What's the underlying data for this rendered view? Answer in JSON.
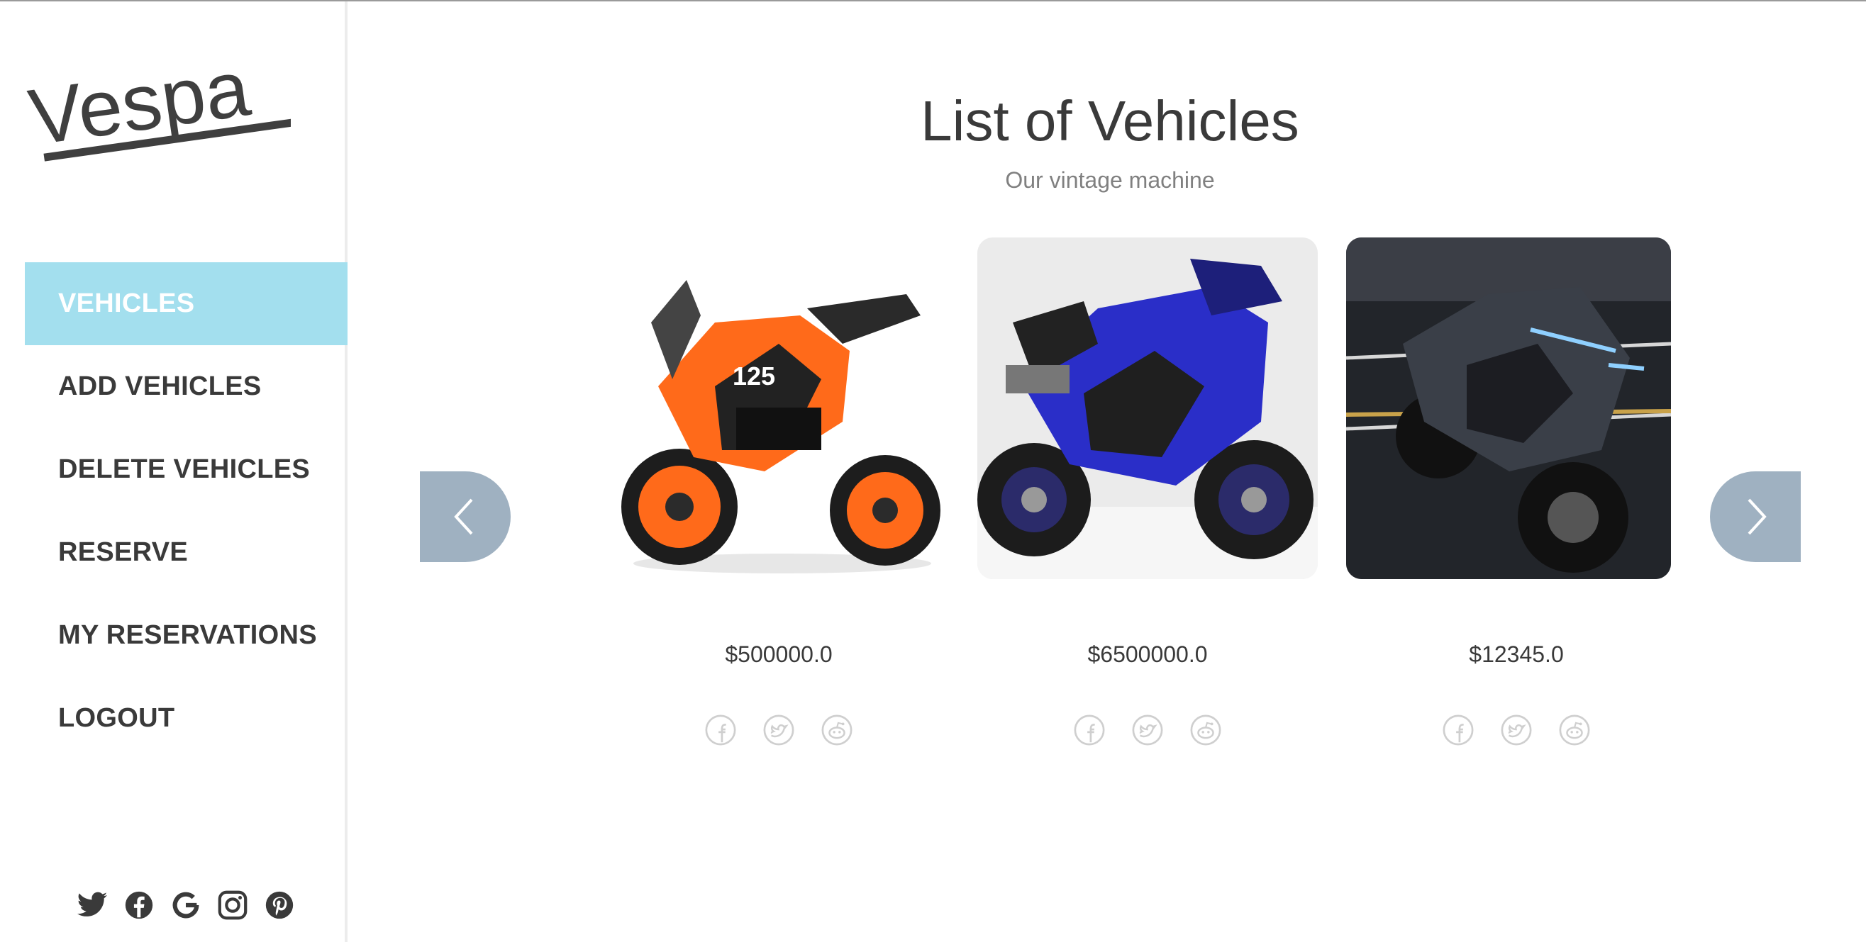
{
  "brand": {
    "logo_text": "Vespa"
  },
  "sidebar": {
    "items": [
      {
        "label": "VEHICLES",
        "active": true
      },
      {
        "label": "ADD VEHICLES"
      },
      {
        "label": "DELETE VEHICLES"
      },
      {
        "label": "RESERVE"
      },
      {
        "label": "MY RESERVATIONS"
      },
      {
        "label": "LOGOUT"
      }
    ],
    "social_icons": [
      "twitter-icon",
      "facebook-icon",
      "google-icon",
      "instagram-icon",
      "pinterest-icon"
    ]
  },
  "main": {
    "title": "List of Vehicles",
    "subtitle": "Our vintage machine",
    "vehicles": [
      {
        "price": "$500000.0",
        "color": "orange"
      },
      {
        "price": "$6500000.0",
        "color": "blue"
      },
      {
        "price": "$12345.0",
        "color": "dark"
      }
    ],
    "card_social_icons": [
      "facebook-icon",
      "twitter-icon",
      "reddit-icon"
    ]
  },
  "colors": {
    "accent": "#a3dfee",
    "arrow_bg": "#9fb1c1",
    "text": "#3a3a3a"
  }
}
